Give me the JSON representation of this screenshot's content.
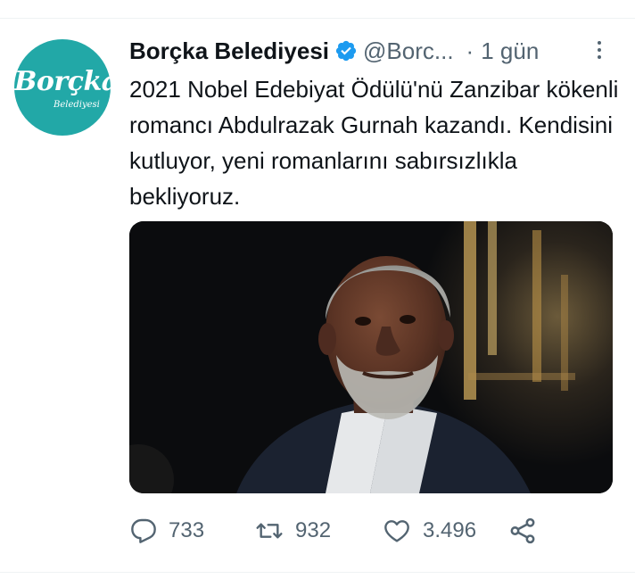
{
  "tweet": {
    "author_name": "Borçka Belediyesi",
    "handle": "@Borc...",
    "separator": "·",
    "time": "1 gün",
    "text": "2021 Nobel Edebiyat Ödülü'nü Zanzibar kökenli romancı Abdulrazak Gurnah kazandı. Kendisini kutluyor, yeni romanlarını sabırsızlıkla bekliyoruz."
  },
  "avatar": {
    "logo_text": "Borçka",
    "logo_subtext": "Belediyesi"
  },
  "stats": {
    "replies": "733",
    "retweets": "932",
    "likes": "3.496"
  },
  "icons": {
    "verified": "verified-badge-icon",
    "reply": "reply-icon",
    "retweet": "retweet-icon",
    "like": "heart-icon",
    "share": "share-icon",
    "more": "more-vertical-icon"
  },
  "colors": {
    "brand": "#1d9bf0",
    "avatar_bg": "#22a8a7",
    "muted": "#536471",
    "text": "#0f1419"
  }
}
